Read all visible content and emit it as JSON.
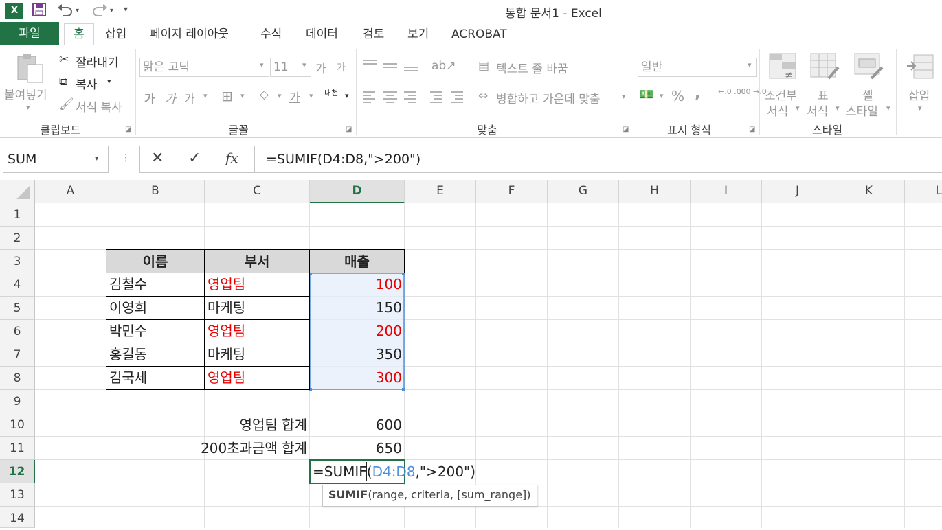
{
  "window": {
    "title": "통합 문서1 - Excel",
    "app_icon": "excel-icon"
  },
  "qat": {
    "save_icon": "save-icon",
    "undo_icon": "undo-icon",
    "redo_icon": "redo-icon",
    "customize_icon": "customize-qat-icon"
  },
  "tabs": {
    "file": "파일",
    "items": [
      "홈",
      "삽입",
      "페이지 레이아웃",
      "수식",
      "데이터",
      "검토",
      "보기",
      "ACROBAT"
    ]
  },
  "ribbon": {
    "clipboard": {
      "paste": "붙여넣기",
      "cut": "잘라내기",
      "copy": "복사",
      "format_painter": "서식 복사",
      "label": "클립보드"
    },
    "font": {
      "font_name": "맑은 고딕",
      "font_size": "11",
      "grow": "가",
      "shrink": "가",
      "bold": "가",
      "italic": "가",
      "underline": "가",
      "font_color": "가",
      "phonetic": "내천",
      "label": "글꼴"
    },
    "alignment": {
      "wrap_text": "텍스트 줄 바꿈",
      "merge_center": "병합하고 가운데 맞춤",
      "label": "맞춤"
    },
    "number": {
      "format": "일반",
      "percent": "%",
      "comma": ",",
      "increase_decimal": "←.0 .00",
      "decrease_decimal": ".00 →.0",
      "label": "표시 형식"
    },
    "styles": {
      "conditional_1": "조건부",
      "conditional_2": "서식",
      "table_1": "표",
      "table_2": "서식",
      "cell_1": "셀",
      "cell_2": "스타일",
      "label": "스타일"
    },
    "cells": {
      "insert": "삽입"
    }
  },
  "formula_bar": {
    "name_box": "SUM",
    "cancel": "✕",
    "enter": "✓",
    "fx": "fx",
    "formula": "=SUMIF(D4:D8,\">200\")"
  },
  "columns": [
    "A",
    "B",
    "C",
    "D",
    "E",
    "F",
    "G",
    "H",
    "I",
    "J",
    "K",
    "L"
  ],
  "rows": [
    "1",
    "2",
    "3",
    "4",
    "5",
    "6",
    "7",
    "8",
    "9",
    "10",
    "11",
    "12",
    "13",
    "14"
  ],
  "table": {
    "headers": [
      "이름",
      "부서",
      "매출"
    ],
    "rows": [
      {
        "name": "김철수",
        "dept": "영업팀",
        "sales": "100"
      },
      {
        "name": "이영희",
        "dept": "마케팅",
        "sales": "150"
      },
      {
        "name": "박민수",
        "dept": "영업팀",
        "sales": "200"
      },
      {
        "name": "홍길동",
        "dept": "마케팅",
        "sales": "350"
      },
      {
        "name": "김국세",
        "dept": "영업팀",
        "sales": "300"
      }
    ]
  },
  "summary": {
    "label1": "영업팀 합계",
    "value1": "600",
    "label2": "200초과금액 합계",
    "value2": "650"
  },
  "editing": {
    "prefix": "=SUMIF(",
    "ref": "D4:D8",
    "suffix": ",\">200\")",
    "tooltip_fn": "SUMIF",
    "tooltip_args": "(range, criteria, [sum_range])"
  },
  "colors": {
    "excel_green": "#217346",
    "red_text": "#e60000",
    "selection_blue": "#4d8fd8"
  }
}
